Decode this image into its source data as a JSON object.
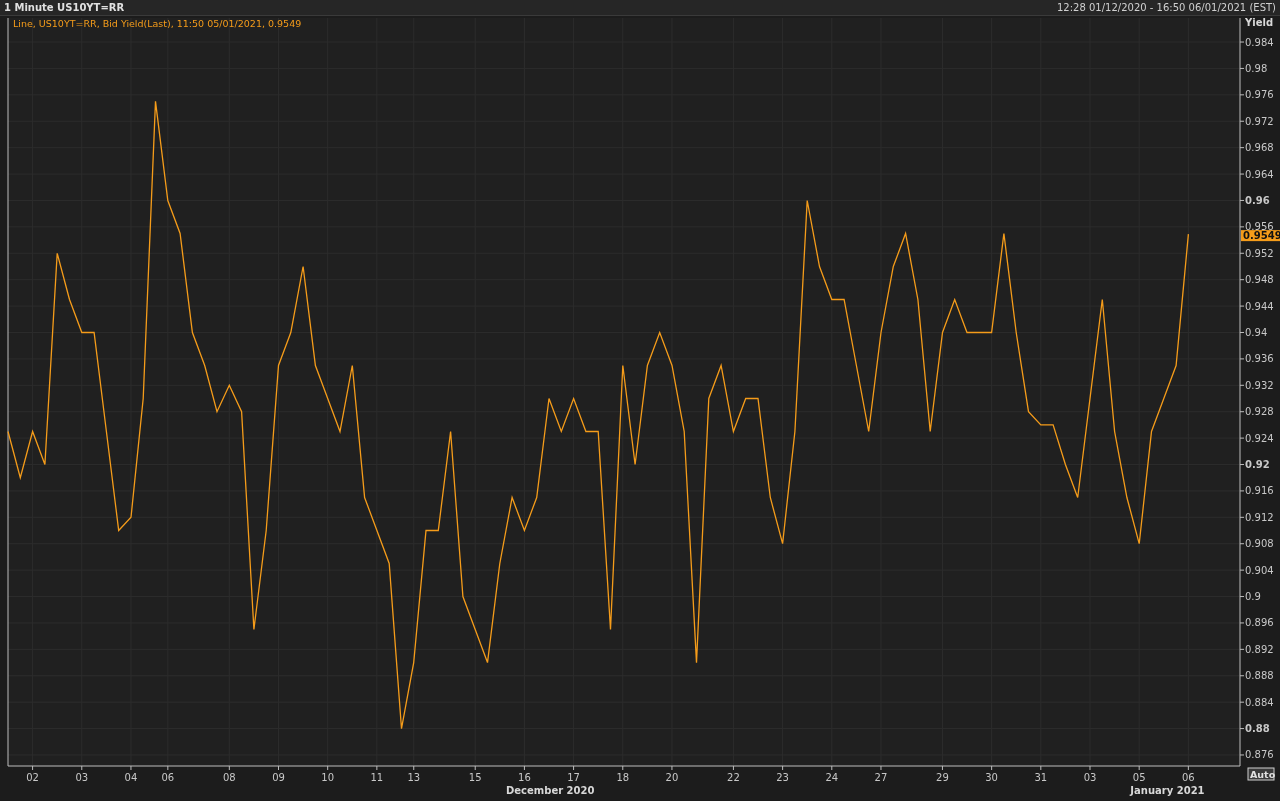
{
  "window": {
    "title": "1 Minute US10YT=RR",
    "date_range": "12:28 01/12/2020 - 16:50 06/01/2021 (EST)"
  },
  "chart": {
    "legend_prefix": "Line, ",
    "legend_suffix": ",  11:50 05/01/2021, 0.9549",
    "last_value": "0.9549",
    "auto_button": "Auto",
    "month_labels": [
      {
        "label": "December 2020"
      },
      {
        "label": "January 2021"
      }
    ],
    "chart_data": {
      "type": "line",
      "ylabel": "Yield",
      "grid": true,
      "ylim": [
        0.87433,
        0.98764
      ],
      "categories": [
        null,
        null,
        "02",
        null,
        null,
        null,
        "03",
        null,
        null,
        null,
        "04",
        null,
        null,
        "06",
        null,
        null,
        null,
        null,
        "08",
        null,
        null,
        null,
        "09",
        null,
        null,
        null,
        "10",
        null,
        null,
        null,
        "11",
        null,
        null,
        "13",
        null,
        null,
        null,
        null,
        "15",
        null,
        null,
        null,
        "16",
        null,
        null,
        null,
        "17",
        null,
        null,
        null,
        "18",
        null,
        null,
        null,
        "20",
        null,
        null,
        null,
        null,
        "22",
        null,
        null,
        null,
        "23",
        null,
        null,
        null,
        "24",
        null,
        null,
        null,
        "27",
        null,
        null,
        null,
        null,
        "29",
        null,
        null,
        null,
        "30",
        null,
        null,
        null,
        "31",
        null,
        null,
        null,
        "03",
        null,
        null,
        null,
        "05",
        null,
        null,
        null,
        "06"
      ],
      "yticks": [
        {
          "value": 0.876,
          "label": "0.876"
        },
        {
          "value": 0.88,
          "label": "0.88"
        },
        {
          "value": 0.884,
          "label": "0.884"
        },
        {
          "value": 0.888,
          "label": "0.888"
        },
        {
          "value": 0.892,
          "label": "0.892"
        },
        {
          "value": 0.896,
          "label": "0.896"
        },
        {
          "value": 0.9,
          "label": "0.9"
        },
        {
          "value": 0.904,
          "label": "0.904"
        },
        {
          "value": 0.908,
          "label": "0.908"
        },
        {
          "value": 0.912,
          "label": "0.912"
        },
        {
          "value": 0.916,
          "label": "0.916"
        },
        {
          "value": 0.92,
          "label": "0.92"
        },
        {
          "value": 0.924,
          "label": "0.924"
        },
        {
          "value": 0.928,
          "label": "0.928"
        },
        {
          "value": 0.932,
          "label": "0.932"
        },
        {
          "value": 0.936,
          "label": "0.936"
        },
        {
          "value": 0.94,
          "label": "0.94"
        },
        {
          "value": 0.944,
          "label": "0.944"
        },
        {
          "value": 0.948,
          "label": "0.948"
        },
        {
          "value": 0.952,
          "label": "0.952"
        },
        {
          "value": 0.956,
          "label": "0.956"
        },
        {
          "value": 0.96,
          "label": "0.96"
        },
        {
          "value": 0.964,
          "label": "0.964"
        },
        {
          "value": 0.968,
          "label": "0.968"
        },
        {
          "value": 0.972,
          "label": "0.972"
        },
        {
          "value": 0.976,
          "label": "0.976"
        },
        {
          "value": 0.98,
          "label": "0.98"
        },
        {
          "value": 0.984,
          "label": "0.984"
        }
      ],
      "series": [
        {
          "name": "US10YT=RR, Bid Yield(Last)",
          "color": "#f59c1a",
          "values": [
            0.925,
            0.918,
            0.925,
            0.92,
            0.952,
            0.945,
            0.94,
            0.94,
            0.925,
            0.91,
            0.912,
            0.93,
            0.975,
            0.96,
            0.955,
            0.94,
            0.935,
            0.928,
            0.932,
            0.928,
            0.895,
            0.91,
            0.935,
            0.94,
            0.95,
            0.935,
            0.93,
            0.925,
            0.935,
            0.915,
            0.91,
            0.905,
            0.88,
            0.89,
            0.91,
            0.91,
            0.925,
            0.9,
            0.895,
            0.89,
            0.905,
            0.915,
            0.91,
            0.915,
            0.93,
            0.925,
            0.93,
            0.925,
            0.925,
            0.895,
            0.935,
            0.92,
            0.935,
            0.94,
            0.935,
            0.925,
            0.89,
            0.93,
            0.935,
            0.925,
            0.93,
            0.93,
            0.915,
            0.908,
            0.925,
            0.96,
            0.95,
            0.945,
            0.945,
            0.935,
            0.925,
            0.94,
            0.95,
            0.955,
            0.945,
            0.925,
            0.94,
            0.945,
            0.94,
            0.94,
            0.94,
            0.955,
            0.94,
            0.928,
            0.926,
            0.926,
            0.92,
            0.915,
            0.93,
            0.945,
            0.925,
            0.915,
            0.908,
            0.925,
            0.93,
            0.935,
            0.9549
          ]
        }
      ]
    }
  }
}
